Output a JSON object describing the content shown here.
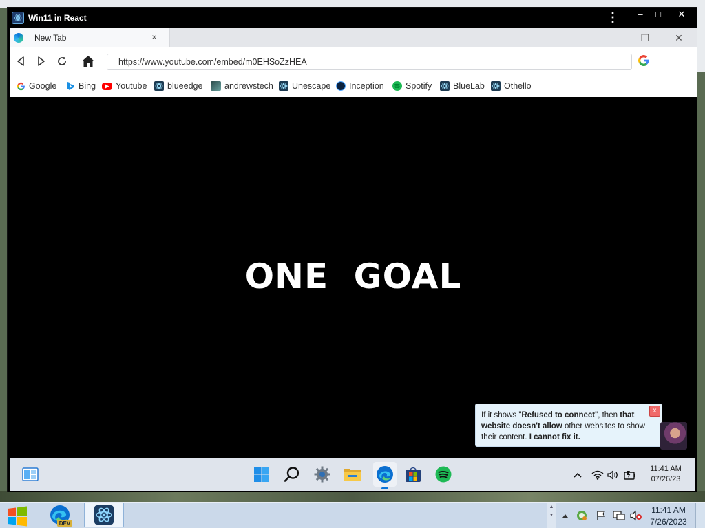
{
  "outer_window": {
    "title": "Win11 in React",
    "menu_icon": "more-vertical-icon",
    "controls": {
      "minimize": "–",
      "maximize": "□",
      "close": "✕"
    }
  },
  "browser": {
    "tab": {
      "title": "New Tab",
      "close": "×",
      "favicon": "edge-icon"
    },
    "window_controls": {
      "minimize": "–",
      "restore": "❐",
      "close": "✕"
    },
    "toolbar": {
      "url": "https://www.youtube.com/embed/m0EHSoZzHEA",
      "buttons": [
        "back-icon",
        "forward-icon",
        "reload-icon",
        "home-icon",
        "google-icon"
      ]
    },
    "bookmarks": [
      {
        "label": "Google",
        "icon": "google-icon"
      },
      {
        "label": "Bing",
        "icon": "bing-icon"
      },
      {
        "label": "Youtube",
        "icon": "youtube-icon"
      },
      {
        "label": "blueedge",
        "icon": "react-icon"
      },
      {
        "label": "andrewstech",
        "icon": "andrewstech-icon"
      },
      {
        "label": "Unescape",
        "icon": "react-icon"
      },
      {
        "label": "Inception",
        "icon": "inception-icon"
      },
      {
        "label": "Spotify",
        "icon": "spotify-icon"
      },
      {
        "label": "BlueLab",
        "icon": "react-icon"
      },
      {
        "label": "Othello",
        "icon": "react-icon"
      }
    ]
  },
  "content": {
    "video_text": "ONE GOAL"
  },
  "notice": {
    "t1": "If it shows \"",
    "b1": "Refused to connect",
    "t2": "\", then ",
    "b2": "that website doesn't allow",
    "t3": " other websites to show their content. ",
    "b3": "I cannot fix it.",
    "close": "x"
  },
  "inner_taskbar": {
    "apps": [
      "widgets-icon",
      "windows-start-icon",
      "search-icon",
      "settings-icon",
      "file-explorer-icon",
      "edge-icon",
      "store-icon",
      "spotify-icon"
    ],
    "tray": [
      "chevron-up-icon",
      "wifi-icon",
      "volume-icon",
      "battery-icon"
    ],
    "time": "11:41 AM",
    "date": "07/26/23"
  },
  "host_taskbar": {
    "apps": [
      "windows-start-icon",
      "edge-dev-icon",
      "react-app-icon"
    ],
    "edge_dev_badge": "DEV",
    "tray": [
      "chevron-up-icon",
      "update-icon",
      "action-center-flag-icon",
      "network-icon",
      "volume-muted-icon"
    ],
    "time": "11:41 AM",
    "date": "7/26/2023"
  },
  "colors": {
    "accent": "#0a74d9",
    "notice_bg": "#e6f3fb",
    "notice_close": "#f06a6a",
    "spotify": "#1db954",
    "youtube": "#ff0000"
  }
}
